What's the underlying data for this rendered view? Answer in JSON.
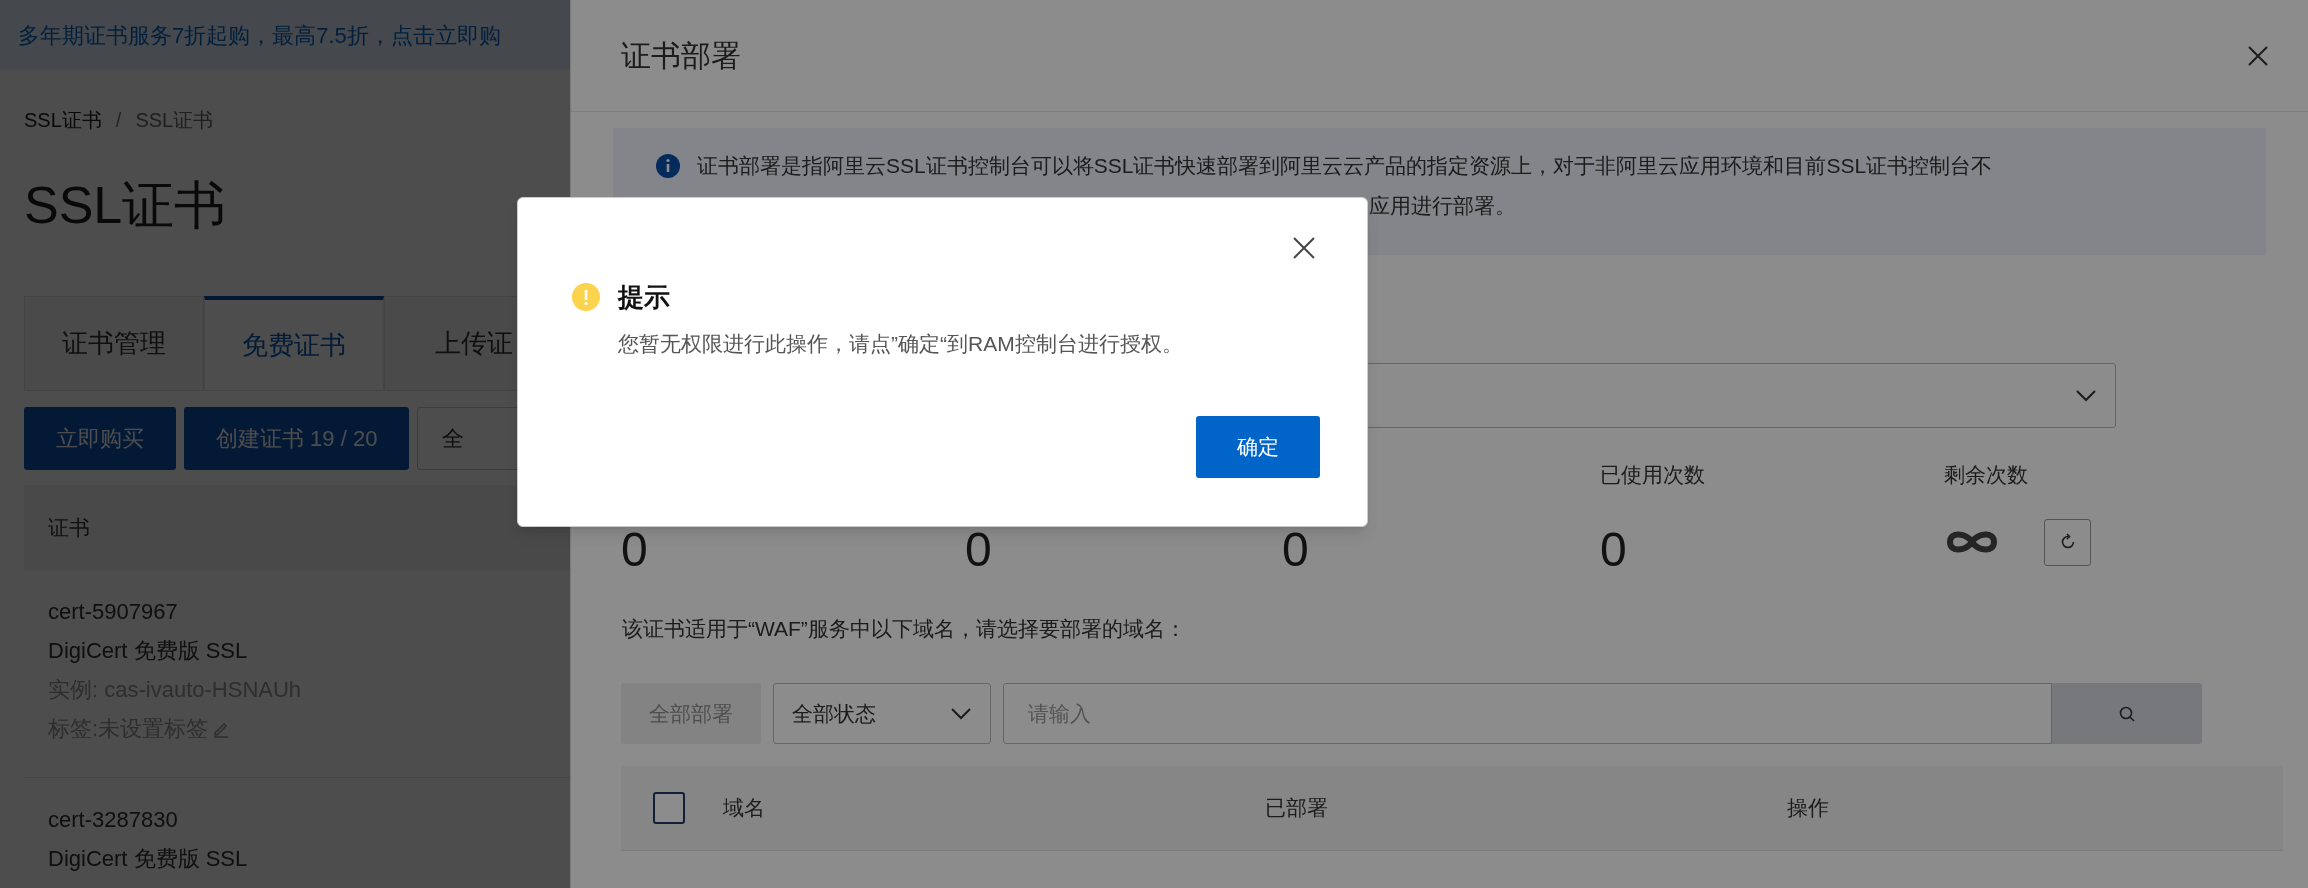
{
  "banner": {
    "text": "多年期证书服务7折起购，最高7.5折，点击立即购"
  },
  "breadcrumb_separator": "/",
  "breadcrumb": [
    {
      "label": "SSL证书",
      "current": false
    },
    {
      "label": "SSL证书",
      "current": true
    }
  ],
  "page_title": "SSL证书",
  "tabs": [
    {
      "label": "证书管理",
      "selected": false
    },
    {
      "label": "免费证书",
      "selected": true
    },
    {
      "label": "上传证",
      "selected": false
    }
  ],
  "actions": [
    {
      "label": "立即购买",
      "kind": "primary"
    },
    {
      "label": "创建证书 19 / 20",
      "kind": "primary"
    },
    {
      "label": "全",
      "kind": "outline"
    }
  ],
  "cert_table": {
    "columns": [
      "证书"
    ],
    "rows": [
      {
        "id": "cert-5907967",
        "product": "DigiCert 免费版 SSL",
        "instance": "实例: cas-ivauto-HSNAUh",
        "tags": "标签:未设置标签"
      },
      {
        "id": "cert-3287830",
        "product": "DigiCert 免费版 SSL"
      }
    ]
  },
  "drawer": {
    "title": "证书部署",
    "notice_lines": [
      "证书部署是指阿里云SSL证书控制台可以将SSL证书快速部署到阿里云云产品的指定资源上，对于非阿里云应用环境和目前SSL证书控制台不",
      "应用进行部署。"
    ],
    "stats": [
      {
        "kind": "count",
        "value": "0"
      },
      {
        "kind": "count",
        "value": "0"
      },
      {
        "kind": "count",
        "value": "0"
      },
      {
        "kind": "count",
        "label": "已使用次数",
        "value": "0"
      },
      {
        "kind": "unlimited",
        "label": "剩余次数"
      }
    ],
    "hint": "该证书适用于“WAF”服务中以下域名，请选择要部署的域名：",
    "deploy_all": {
      "label": "全部部署",
      "disabled": true
    },
    "status_filter": {
      "value": "全部状态"
    },
    "search": {
      "placeholder": "请输入"
    },
    "domain_table": {
      "select_all_checked": false,
      "columns": [
        "域名",
        "已部署",
        "操作"
      ]
    }
  },
  "dialog": {
    "title": "提示",
    "message": "您暂无权限进行此操作，请点”确定“到RAM控制台进行授权。",
    "button": "确定"
  }
}
